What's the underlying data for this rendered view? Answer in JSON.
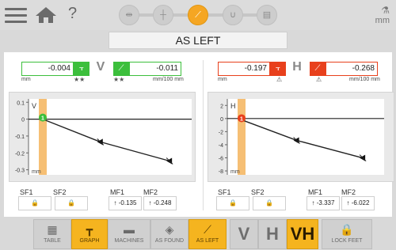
{
  "header": {
    "help": "?",
    "units": "mm",
    "page_title": "AS LEFT",
    "steps": [
      {
        "icon": "dimensions-icon",
        "glyph": "⇹",
        "active": false
      },
      {
        "icon": "sensor-position-icon",
        "glyph": "┼",
        "active": false
      },
      {
        "icon": "measure-icon",
        "glyph": "⟋",
        "active": true
      },
      {
        "icon": "coupling-icon",
        "glyph": "∪",
        "active": false
      },
      {
        "icon": "report-icon",
        "glyph": "▤",
        "active": false
      }
    ]
  },
  "vertical": {
    "letter": "V",
    "offset": "-0.004",
    "angle": "-0.011",
    "unit_left": "mm",
    "unit_right": "mm/100 mm",
    "stars_left": "★★",
    "stars_right": "★★",
    "color": "#3cbf3c",
    "sf1_label": "SF1",
    "sf2_label": "SF2",
    "mf1_label": "MF1",
    "mf2_label": "MF2",
    "mf1_value": "-0.135",
    "mf2_value": "-0.248"
  },
  "horizontal": {
    "letter": "H",
    "offset": "-0.197",
    "angle": "-0.268",
    "unit_left": "mm",
    "unit_right": "mm/100 mm",
    "warn_left": "⚠",
    "warn_right": "⚠",
    "color": "#e8401c",
    "sf1_label": "SF1",
    "sf2_label": "SF2",
    "mf1_label": "MF1",
    "mf2_label": "MF2",
    "mf1_value": "-3.337",
    "mf2_value": "-6.022"
  },
  "chart_data": [
    {
      "type": "line",
      "title": "V",
      "ylabel": "mm",
      "yticks": [
        "0.1",
        "0",
        "-0.1",
        "-0.2",
        "-0.3"
      ],
      "ylim": [
        -0.33,
        0.12
      ],
      "x": [
        0,
        0.4,
        0.88
      ],
      "y": [
        0,
        -0.135,
        -0.248
      ],
      "coupling_marker": "1",
      "coupling_color": "#3cbf3c"
    },
    {
      "type": "line",
      "title": "H",
      "ylabel": "mm",
      "yticks": [
        "2",
        "0",
        "-2",
        "-4",
        "-6",
        "-8"
      ],
      "ylim": [
        -8.6,
        3
      ],
      "x": [
        0,
        0.4,
        0.88
      ],
      "y": [
        -0.197,
        -3.337,
        -6.022
      ],
      "coupling_marker": "1",
      "coupling_color": "#e8401c"
    }
  ],
  "toolbar": {
    "table": "TABLE",
    "graph": "GRAPH",
    "machines": "MACHINES",
    "as_found": "AS FOUND",
    "as_left": "AS LEFT",
    "v": "V",
    "h": "H",
    "vh": "VH",
    "lock_feet": "LOCK FEET"
  }
}
